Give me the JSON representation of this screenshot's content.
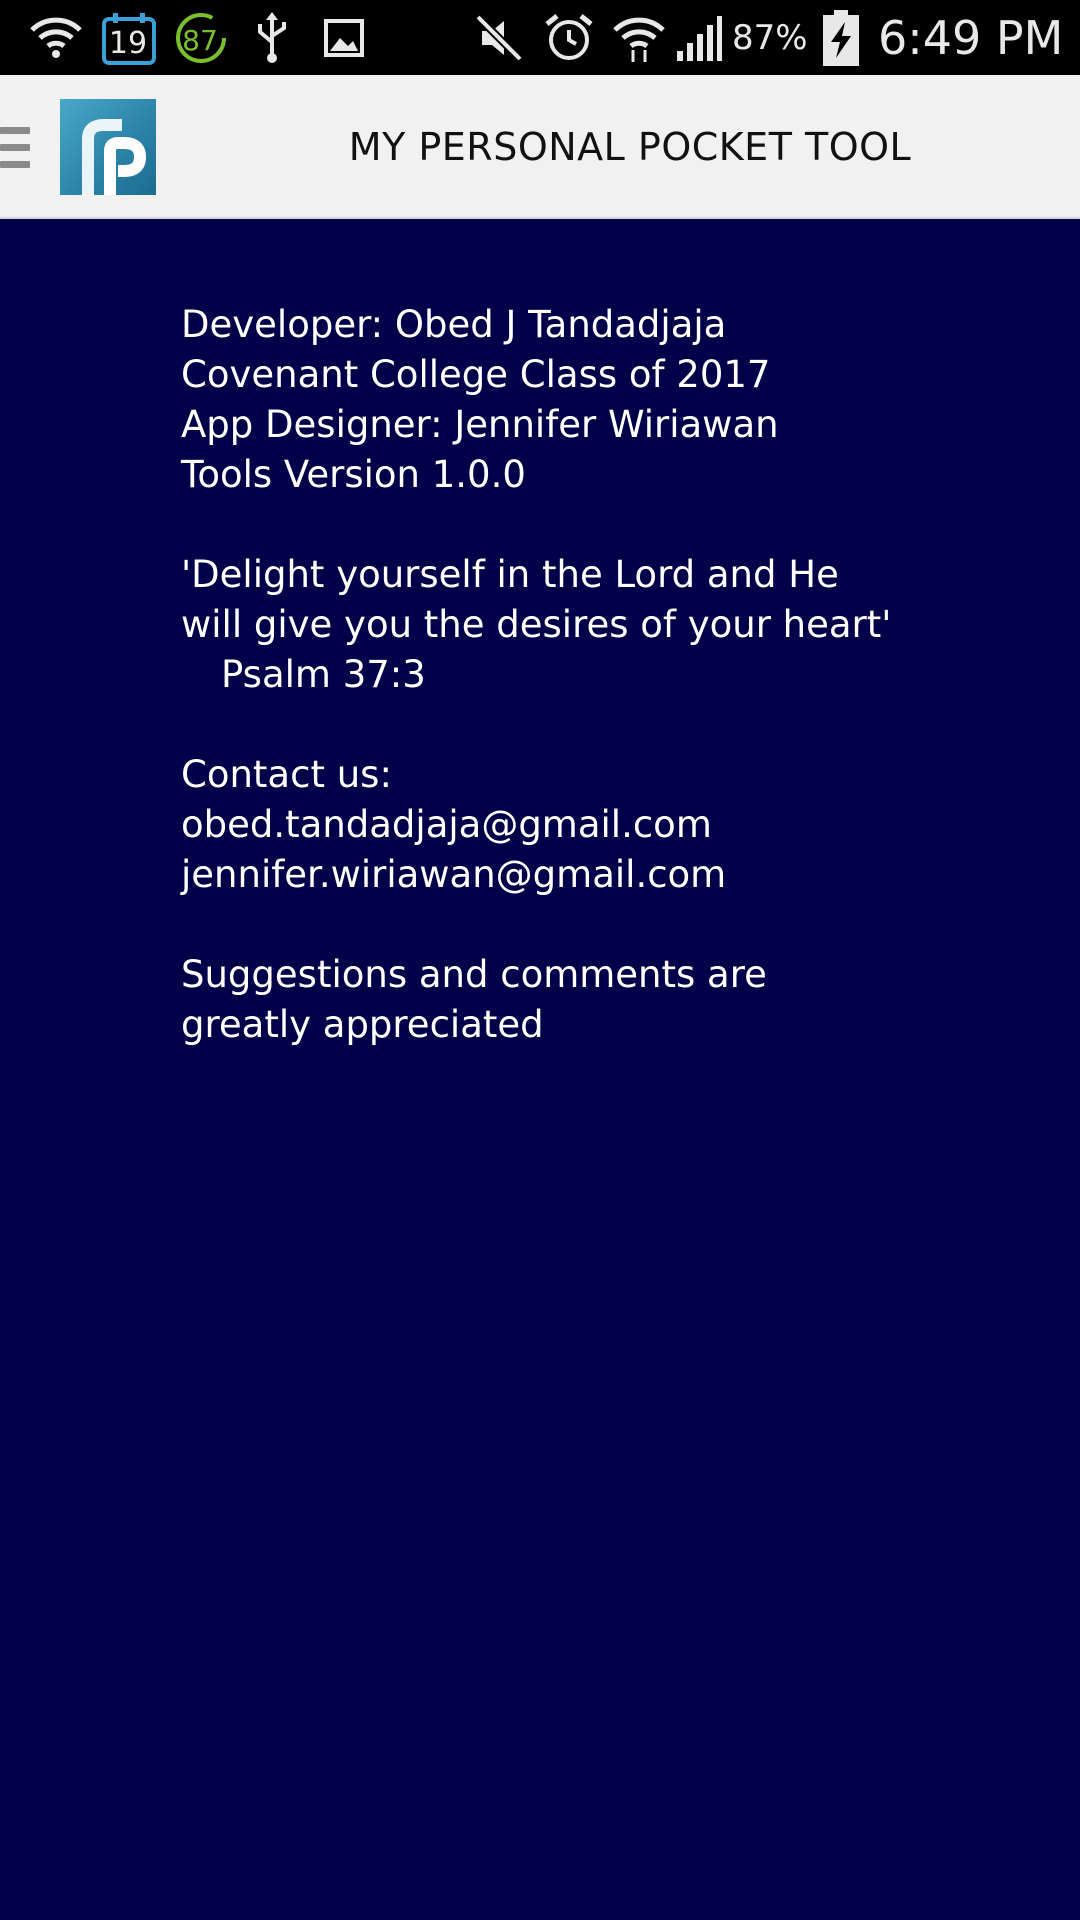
{
  "status_bar": {
    "calendar_day": "19",
    "circle_badge": "87",
    "battery_percent": "87%",
    "time": "6:49 PM",
    "icons": [
      "wifi-question-icon",
      "calendar-icon",
      "circle-87-icon",
      "usb-icon",
      "image-icon",
      "mute-icon",
      "alarm-icon",
      "wifi-icon",
      "signal-icon",
      "battery-charging-icon"
    ]
  },
  "header": {
    "menu_icon": "hamburger-menu-icon",
    "logo_letter": "P",
    "title": "MY PERSONAL POCKET TOOL"
  },
  "about": {
    "developer": "Developer: Obed J Tandadjaja",
    "college": "Covenant College Class of 2017",
    "designer": "App Designer: Jennifer Wiriawan",
    "version": "Tools Version 1.0.0",
    "quote_line1": "'Delight yourself in the Lord and He",
    "quote_line2": "will give you the desires of your heart'",
    "quote_ref": "Psalm 37:3",
    "contact_label": "Contact us:",
    "email_1": "obed.tandadjaja@gmail.com",
    "email_2": "jennifer.wiriawan@gmail.com",
    "feedback_line1": "Suggestions and comments are",
    "feedback_line2": "greatly appreciated"
  },
  "colors": {
    "background": "#03004a",
    "header_background": "#f1f1f1",
    "logo": "#2c85aa",
    "text": "#ffffff"
  }
}
